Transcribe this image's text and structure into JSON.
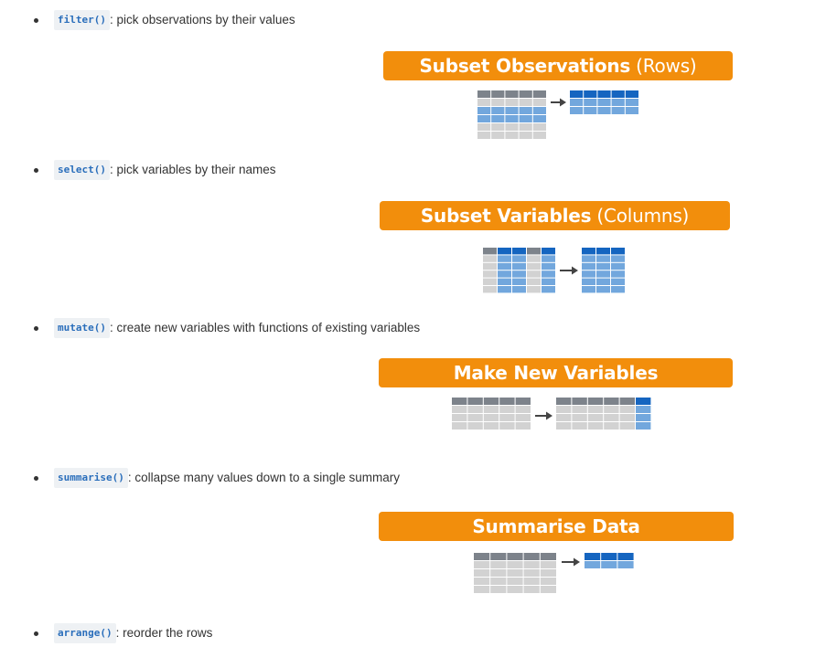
{
  "colors": {
    "banner": "#f28e0c",
    "header_gray": "#7d838b",
    "cell_gray": "#d2d2d2",
    "header_blue": "#1565c0",
    "cell_blue": "#72a7dd",
    "code_text": "#2a6ebb"
  },
  "items": [
    {
      "code": "filter()",
      "desc": ": pick observations by their values"
    },
    {
      "code": "select()",
      "desc": ": pick variables by their names"
    },
    {
      "code": "mutate()",
      "desc": ": create new variables with functions of existing variables"
    },
    {
      "code": "summarise()",
      "desc": ": collapse many values down to a single summary"
    },
    {
      "code": "arrange()",
      "desc": ": reorder the rows"
    }
  ],
  "banners": [
    {
      "bold": "Subset Observations",
      "light": "(Rows)"
    },
    {
      "bold": "Subset Variables",
      "light": "(Columns)"
    },
    {
      "bold": "Make New Variables",
      "light": ""
    },
    {
      "bold": "Summarise Data",
      "light": ""
    }
  ],
  "arrow_icon": "right-arrow-icon"
}
